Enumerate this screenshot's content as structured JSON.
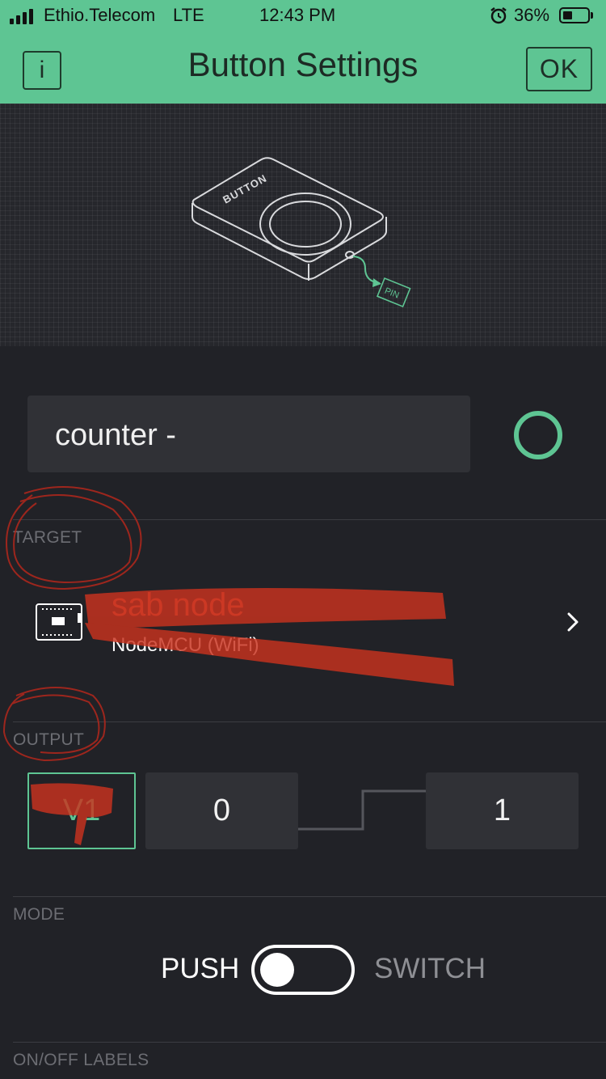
{
  "status_bar": {
    "carrier": "Ethio.Telecom",
    "network": "LTE",
    "time": "12:43 PM",
    "battery_percent": "36%",
    "battery_level": 0.36,
    "alarm_icon": "alarm-clock-icon",
    "signal_icon": "cellular-signal-icon"
  },
  "nav": {
    "info_label": "i",
    "title": "Button Settings",
    "ok_label": "OK"
  },
  "illustration": {
    "device_label": "BUTTON",
    "pin_label": "PIN"
  },
  "widget": {
    "name": "counter -",
    "color": "#5ec593"
  },
  "target": {
    "section_label": "TARGET",
    "device_name": "sab node",
    "device_type": "NodeMCU (WiFi)",
    "device_icon": "microcontroller-board-icon",
    "chevron_icon": "chevron-right-icon"
  },
  "output": {
    "section_label": "OUTPUT",
    "pin": "V1",
    "low_value": "0",
    "high_value": "1"
  },
  "mode": {
    "section_label": "MODE",
    "push_label": "PUSH",
    "switch_label": "SWITCH",
    "selected": "PUSH"
  },
  "labels_section": {
    "section_label": "ON/OFF LABELS"
  },
  "colors": {
    "accent": "#5ec593",
    "background": "#212227",
    "field": "#303136",
    "annotation_red": "#d8563d"
  }
}
